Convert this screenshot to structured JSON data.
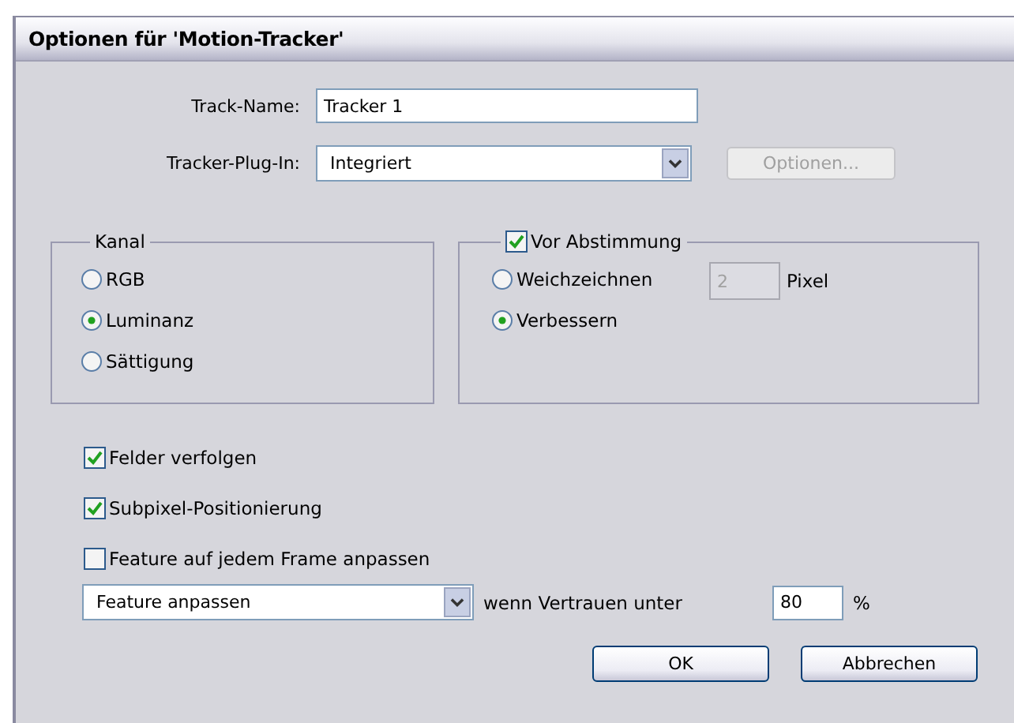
{
  "window": {
    "title": "Optionen für 'Motion-Tracker'"
  },
  "track_name": {
    "label": "Track-Name:",
    "value": "Tracker 1"
  },
  "tracker_plugin": {
    "label": "Tracker-Plug-In:",
    "value": "Integriert",
    "options_button": {
      "label": "Optionen...",
      "disabled": true
    }
  },
  "kanal": {
    "title": "Kanal",
    "options": [
      {
        "label": "RGB",
        "selected": false
      },
      {
        "label": "Luminanz",
        "selected": true
      },
      {
        "label": "Sättigung",
        "selected": false
      }
    ]
  },
  "vor_abstimmung": {
    "label": "Vor Abstimmung",
    "checked": true,
    "options": [
      {
        "label": "Weichzeichnen",
        "selected": false
      },
      {
        "label": "Verbessern",
        "selected": true
      }
    ],
    "pixel_value": "2",
    "pixel_unit": "Pixel"
  },
  "checkboxes": [
    {
      "label": "Felder verfolgen",
      "checked": true
    },
    {
      "label": "Subpixel-Positionierung",
      "checked": true
    },
    {
      "label": "Feature auf jedem Frame anpassen",
      "checked": false
    }
  ],
  "adapt": {
    "action": "Feature anpassen",
    "condition": "wenn Vertrauen unter",
    "threshold": "80",
    "unit": "%"
  },
  "buttons": [
    {
      "label": "OK"
    },
    {
      "label": "Abbrechen"
    }
  ]
}
